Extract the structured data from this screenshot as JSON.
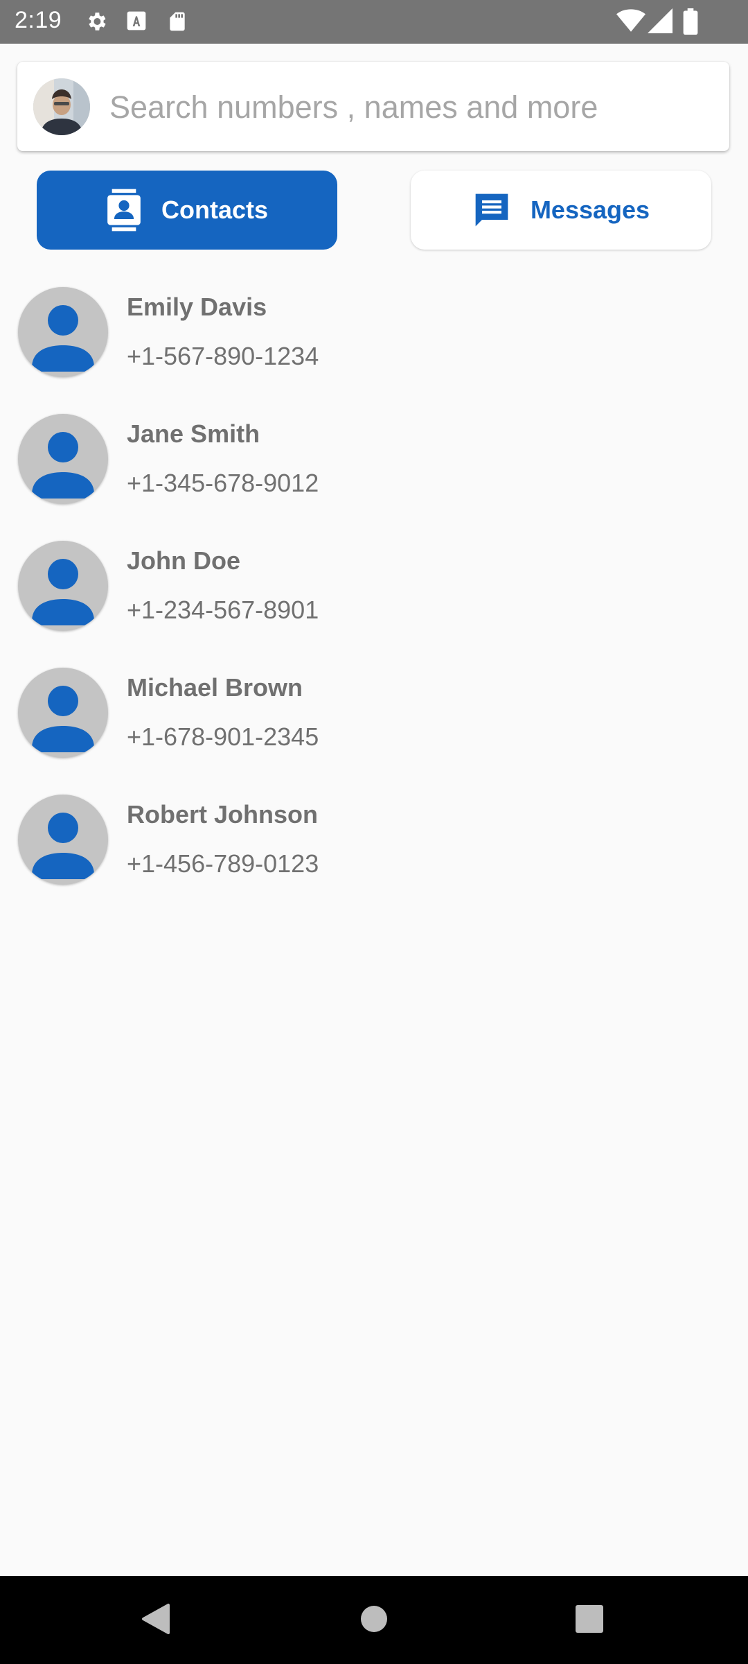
{
  "status_bar": {
    "time": "2:19",
    "left_icons": [
      "settings-icon",
      "font-a-icon",
      "sd-card-icon"
    ],
    "right_icons": [
      "wifi-icon",
      "signal-icon",
      "battery-icon"
    ]
  },
  "search": {
    "placeholder": "Search numbers , names and more"
  },
  "tabs": [
    {
      "label": "Contacts",
      "icon": "contact-card-icon",
      "active": true
    },
    {
      "label": "Messages",
      "icon": "message-icon",
      "active": false
    }
  ],
  "contacts": [
    {
      "name": "Emily Davis",
      "phone": "+1-567-890-1234"
    },
    {
      "name": "Jane Smith",
      "phone": "+1-345-678-9012"
    },
    {
      "name": "John Doe",
      "phone": "+1-234-567-8901"
    },
    {
      "name": "Michael Brown",
      "phone": "+1-678-901-2345"
    },
    {
      "name": "Robert Johnson",
      "phone": "+1-456-789-0123"
    }
  ],
  "nav": {
    "buttons": [
      "back-icon",
      "home-icon",
      "recents-icon"
    ]
  },
  "colors": {
    "accent": "#1565c0",
    "status_bar": "#757575",
    "background": "#fafafa",
    "text_secondary": "#707070"
  }
}
